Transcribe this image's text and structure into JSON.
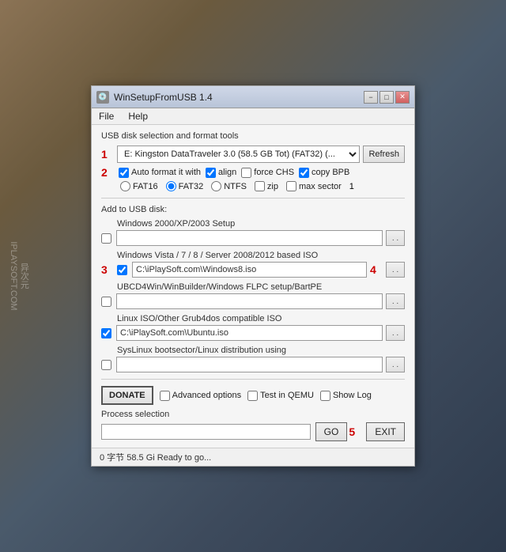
{
  "watermark": {
    "line1": "异次元",
    "line2": "IPLAYSOFT.COM"
  },
  "window": {
    "title": "WinSetupFromUSB 1.4",
    "icon": "💿"
  },
  "titlebar": {
    "minimize": "−",
    "maximize": "□",
    "close": "✕"
  },
  "menu": {
    "file": "File",
    "help": "Help"
  },
  "usb_section": {
    "label": "USB disk selection and format tools",
    "num1": "1",
    "drive_value": "E: Kingston DataTraveler 3.0 (58.5 GB Tot) (FAT32) (...",
    "refresh": "Refresh"
  },
  "format": {
    "num2": "2",
    "auto_format_label": "Auto format it with ",
    "align_label": "align",
    "force_chs_label": "force CHS",
    "copy_bpb_label": "copy BPB",
    "fat16_label": "FAT16",
    "fat32_label": "FAT32",
    "ntfs_label": "NTFS",
    "zip_label": "zip",
    "max_sector_label": "max sector",
    "max_sector_value": "1"
  },
  "add_to_usb": {
    "label": "Add to USB disk:",
    "rows": [
      {
        "id": "win2000",
        "title": "Windows 2000/XP/2003 Setup",
        "checked": false,
        "path": ""
      },
      {
        "id": "winvista",
        "title": "Windows Vista / 7 / 8 / Server 2008/2012 based ISO",
        "checked": true,
        "path": "C:\\iPlaySoft.com\\Windows8.iso"
      },
      {
        "id": "ubcd",
        "title": "UBCD4Win/WinBuilder/Windows FLPC setup/BartPE",
        "checked": false,
        "path": ""
      },
      {
        "id": "linux",
        "title": "Linux ISO/Other Grub4dos compatible ISO",
        "checked": true,
        "path": "C:\\iPlaySoft.com\\Ubuntu.iso"
      },
      {
        "id": "syslinux",
        "title": "SysLinux bootsector/Linux distribution using",
        "checked": false,
        "path": ""
      }
    ]
  },
  "badges": {
    "num3": "3",
    "num4": "4",
    "num5": "5"
  },
  "bottom": {
    "donate": "DONATE",
    "advanced_options": "Advanced options",
    "test_in_qemu": "Test in QEMU",
    "show_log": "Show Log",
    "process_selection": "Process selection",
    "go": "GO",
    "exit": "EXIT"
  },
  "status_bar": {
    "text": "0 字节  58.5 Gi  Ready to go..."
  }
}
